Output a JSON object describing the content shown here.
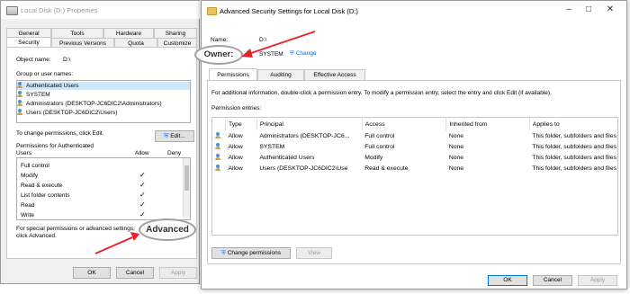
{
  "properties": {
    "title": "Local Disk (D:) Properties",
    "tabs_row1": [
      "General",
      "Tools",
      "Hardware",
      "Sharing"
    ],
    "tabs_row2": [
      "Security",
      "Previous Versions",
      "Quota",
      "Customize"
    ],
    "object_name_label": "Object name:",
    "object_name_value": "D:\\",
    "group_label": "Group or user names:",
    "users": [
      "Authenticated Users",
      "SYSTEM",
      "Administrators (DESKTOP-JC6DIC2\\Administrators)",
      "Users (DESKTOP-JC6DIC2\\Users)"
    ],
    "change_text": "To change permissions, click Edit.",
    "edit_button": "Edit...",
    "perm_for": "Permissions for Authenticated",
    "perm_for2": "Users",
    "allow_header": "Allow",
    "deny_header": "Deny",
    "permissions": [
      {
        "name": "Full control",
        "allow": ""
      },
      {
        "name": "Modify",
        "allow": "✓"
      },
      {
        "name": "Read & execute",
        "allow": "✓"
      },
      {
        "name": "List folder contents",
        "allow": "✓"
      },
      {
        "name": "Read",
        "allow": "✓"
      },
      {
        "name": "Write",
        "allow": "✓"
      }
    ],
    "special_text": "For special permissions or advanced settings,",
    "special_text2": "click Advanced.",
    "ok": "OK",
    "cancel": "Cancel",
    "apply": "Apply"
  },
  "advanced": {
    "title": "Advanced Security Settings for Local Disk (D:)",
    "name_label": "Name:",
    "name_value": "D:\\",
    "owner_value": "SYSTEM",
    "change_link": "Change",
    "tabs": [
      "Permissions",
      "Auditing",
      "Effective Access"
    ],
    "info_text": "For additional information, double-click a permission entry. To modify a permission entry, select the entry and click Edit (if available).",
    "entries_label": "Permission entries:",
    "columns": [
      "Type",
      "Principal",
      "Access",
      "Inherited from",
      "Applies to"
    ],
    "entries": [
      {
        "type": "Allow",
        "principal": "Administrators (DESKTOP-JC6...",
        "access": "Full control",
        "inherited": "None",
        "applies": "This folder, subfolders and files"
      },
      {
        "type": "Allow",
        "principal": "SYSTEM",
        "access": "Full control",
        "inherited": "None",
        "applies": "This folder, subfolders and files"
      },
      {
        "type": "Allow",
        "principal": "Authenticated Users",
        "access": "Modify",
        "inherited": "None",
        "applies": "This folder, subfolders and files"
      },
      {
        "type": "Allow",
        "principal": "Users (DESKTOP-JC6DIC2\\Use",
        "access": "Read & execute",
        "inherited": "None",
        "applies": "This folder, subfolders and files"
      }
    ],
    "change_permissions": "Change permissions",
    "view": "View",
    "ok": "OK",
    "cancel": "Cancel",
    "apply": "Apply"
  },
  "callouts": {
    "owner": "Owner:",
    "advanced": "Advanced"
  },
  "colors": {
    "arrow": "#e8202a",
    "link": "#0066cc",
    "selection": "#cce8ff"
  }
}
